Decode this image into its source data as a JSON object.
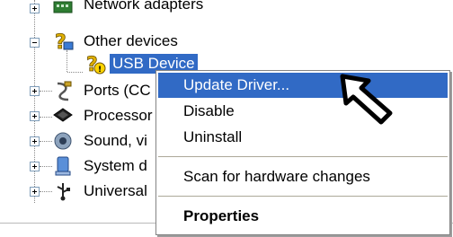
{
  "tree": {
    "items": [
      {
        "label": "Network adapters",
        "icon": "network-adapter-icon",
        "expander": "+"
      },
      {
        "label": "Other devices",
        "icon": "unknown-device-icon",
        "expander": "-"
      },
      {
        "label": "USB Device",
        "icon": "warning-device-icon",
        "selected": true
      },
      {
        "label": "Ports (CC",
        "icon": "port-icon",
        "expander": "+"
      },
      {
        "label": "Processor",
        "icon": "processor-icon",
        "expander": "+"
      },
      {
        "label": "Sound, vi",
        "icon": "sound-icon",
        "expander": "+"
      },
      {
        "label": "System d",
        "icon": "system-device-icon",
        "expander": "+"
      },
      {
        "label": "Universal",
        "icon": "usb-icon",
        "expander": "+"
      }
    ]
  },
  "context_menu": {
    "items": [
      {
        "label": "Update Driver...",
        "highlighted": true
      },
      {
        "label": "Disable"
      },
      {
        "label": "Uninstall"
      },
      {
        "label": "Scan for hardware changes"
      },
      {
        "label": "Properties",
        "bold": true
      }
    ]
  },
  "annotation": {
    "icon": "pointer-arrow-icon"
  },
  "colors": {
    "selection": "#316ac5",
    "menu_border": "#848484",
    "tree_line": "#8a8a8a"
  }
}
